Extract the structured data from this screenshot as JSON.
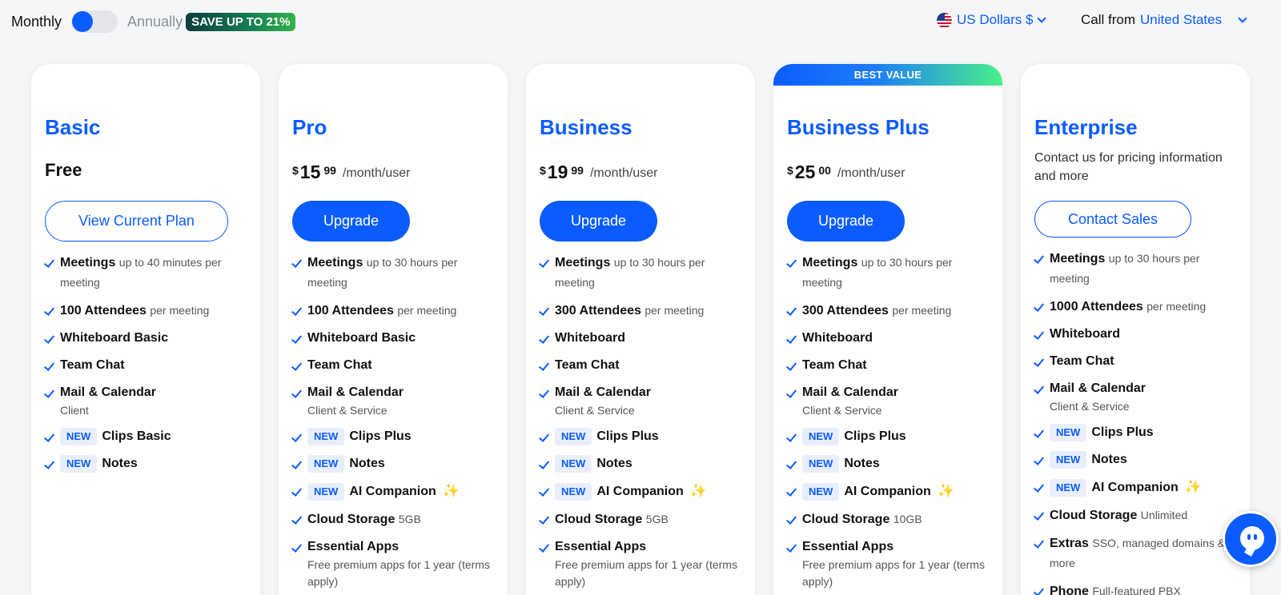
{
  "billing": {
    "monthly_label": "Monthly",
    "annually_label": "Annually",
    "save_badge": "SAVE UP TO 21%",
    "selected": "Monthly"
  },
  "currency": {
    "label": "US Dollars $"
  },
  "call_from": {
    "label": "Call from",
    "country": "United States"
  },
  "colors": {
    "accent": "#0b5cff",
    "badge_bg": "#e8eefb",
    "sparkle": "#e2a90f"
  },
  "plans": [
    {
      "name": "Basic",
      "price_text": "Free",
      "button": "View Current Plan",
      "features": [
        {
          "name": "Meetings",
          "detail": "up to 40 minutes per meeting"
        },
        {
          "name": "100 Attendees",
          "detail": "per meeting"
        },
        {
          "name": "Whiteboard Basic"
        },
        {
          "name": "Team Chat"
        },
        {
          "name": "Mail & Calendar",
          "subline": "Client"
        },
        {
          "badge": "NEW",
          "name": "Clips Basic"
        },
        {
          "badge": "NEW",
          "name": "Notes"
        }
      ]
    },
    {
      "name": "Pro",
      "currency_symbol": "$",
      "price_whole": "15",
      "price_cents": "99",
      "per": "/month/user",
      "button": "Upgrade",
      "features": [
        {
          "name": "Meetings",
          "detail": "up to 30 hours per meeting"
        },
        {
          "name": "100 Attendees",
          "detail": "per meeting"
        },
        {
          "name": "Whiteboard Basic"
        },
        {
          "name": "Team Chat"
        },
        {
          "name": "Mail & Calendar",
          "subline": "Client & Service"
        },
        {
          "badge": "NEW",
          "name": "Clips Plus"
        },
        {
          "badge": "NEW",
          "name": "Notes"
        },
        {
          "badge": "NEW",
          "name": "AI Companion",
          "icon": "sparkle-icon"
        },
        {
          "name": "Cloud Storage",
          "detail": "5GB"
        },
        {
          "name": "Essential Apps",
          "subline": "Free premium apps for 1 year (terms apply)"
        }
      ]
    },
    {
      "name": "Business",
      "currency_symbol": "$",
      "price_whole": "19",
      "price_cents": "99",
      "per": "/month/user",
      "button": "Upgrade",
      "features": [
        {
          "name": "Meetings",
          "detail": "up to 30 hours per meeting"
        },
        {
          "name": "300 Attendees",
          "detail": "per meeting"
        },
        {
          "name": "Whiteboard"
        },
        {
          "name": "Team Chat"
        },
        {
          "name": "Mail & Calendar",
          "subline": "Client & Service"
        },
        {
          "badge": "NEW",
          "name": "Clips Plus"
        },
        {
          "badge": "NEW",
          "name": "Notes"
        },
        {
          "badge": "NEW",
          "name": "AI Companion",
          "icon": "sparkle-icon"
        },
        {
          "name": "Cloud Storage",
          "detail": "5GB"
        },
        {
          "name": "Essential Apps",
          "subline": "Free premium apps for 1 year (terms apply)"
        }
      ]
    },
    {
      "name": "Business Plus",
      "ribbon": "BEST VALUE",
      "currency_symbol": "$",
      "price_whole": "25",
      "price_cents": "00",
      "per": "/month/user",
      "button": "Upgrade",
      "features": [
        {
          "name": "Meetings",
          "detail": "up to 30 hours per meeting"
        },
        {
          "name": "300 Attendees",
          "detail": "per meeting"
        },
        {
          "name": "Whiteboard"
        },
        {
          "name": "Team Chat"
        },
        {
          "name": "Mail & Calendar",
          "subline": "Client & Service"
        },
        {
          "badge": "NEW",
          "name": "Clips Plus"
        },
        {
          "badge": "NEW",
          "name": "Notes"
        },
        {
          "badge": "NEW",
          "name": "AI Companion",
          "icon": "sparkle-icon"
        },
        {
          "name": "Cloud Storage",
          "detail": "10GB"
        },
        {
          "name": "Essential Apps",
          "subline": "Free premium apps for 1 year (terms apply)"
        }
      ]
    },
    {
      "name": "Enterprise",
      "contact_text": "Contact us for pricing information and more",
      "button": "Contact Sales",
      "features": [
        {
          "name": "Meetings",
          "detail": "up to 30 hours per meeting"
        },
        {
          "name": "1000 Attendees",
          "detail": "per meeting"
        },
        {
          "name": "Whiteboard"
        },
        {
          "name": "Team Chat"
        },
        {
          "name": "Mail & Calendar",
          "subline": "Client & Service"
        },
        {
          "badge": "NEW",
          "name": "Clips Plus"
        },
        {
          "badge": "NEW",
          "name": "Notes"
        },
        {
          "badge": "NEW",
          "name": "AI Companion",
          "icon": "sparkle-icon"
        },
        {
          "name": "Cloud Storage",
          "detail": "Unlimited"
        },
        {
          "name": "Extras",
          "detail": "SSO, managed domains & more"
        },
        {
          "name": "Phone",
          "detail": "Full-featured PBX"
        }
      ]
    }
  ]
}
